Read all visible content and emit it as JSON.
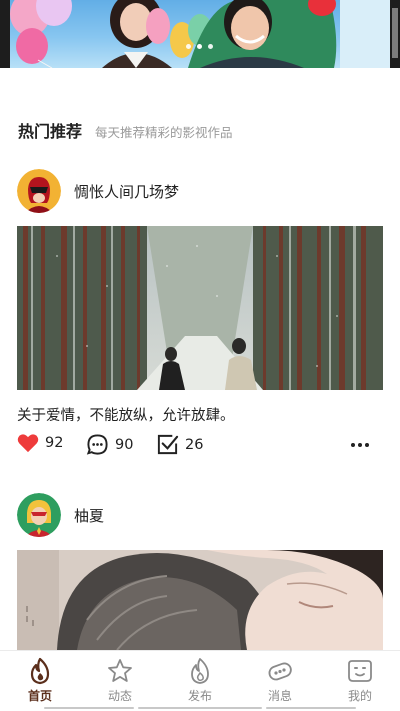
{
  "banner": {
    "page_indicator_count": 3
  },
  "section": {
    "title": "热门推荐",
    "subtitle": "每天推荐精彩的影视作品"
  },
  "posts": [
    {
      "username": "惆怅人间几场梦",
      "avatar_icon": "superhero-avatar-icon",
      "caption": "关于爱情，不能放纵，允许放肆。",
      "likes": "92",
      "comments": "90",
      "collects": "26"
    },
    {
      "username": "柚夏",
      "avatar_icon": "captain-marvel-avatar-icon"
    }
  ],
  "tabbar": {
    "items": [
      {
        "label": "首页",
        "icon": "flame-home-icon",
        "active": true
      },
      {
        "label": "动态",
        "icon": "star-icon",
        "active": false
      },
      {
        "label": "发布",
        "icon": "flame-publish-icon",
        "active": false
      },
      {
        "label": "消息",
        "icon": "message-icon",
        "active": false
      },
      {
        "label": "我的",
        "icon": "profile-icon",
        "active": false
      }
    ]
  },
  "colors": {
    "like": "#ee3b3b",
    "active_tab": "#5b2f1c",
    "inactive_tab": "#8a8a8a",
    "subtitle": "#9a9a9a"
  }
}
